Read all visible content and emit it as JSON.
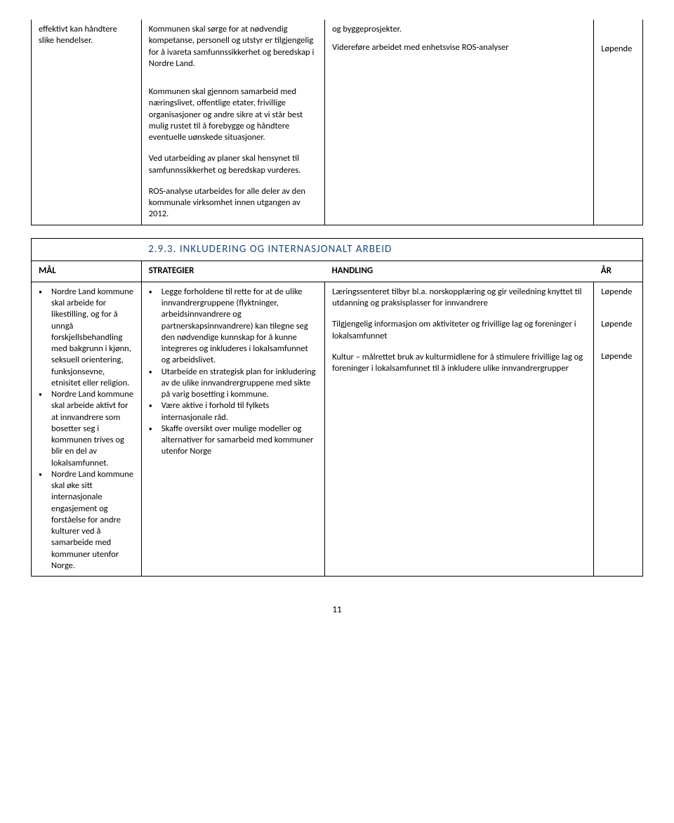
{
  "table1": {
    "row1": {
      "col1": "effektivt kan håndtere slike hendelser.",
      "col2": "Kommunen skal sørge for at nødvendig kompetanse, personell og utstyr er tilgjengelig for å ivareta samfunnssikkerhet og beredskap i Nordre Land.",
      "col3a": "og byggeprosjekter.",
      "col3b": "Videreføre arbeidet med enhetsvise ROS-analyser",
      "col4": "Løpende"
    },
    "row2": {
      "p1": "Kommunen skal gjennom samarbeid med næringslivet, offentlige etater, frivillige organisasjoner og andre sikre at vi står best mulig rustet til å forebygge og håndtere eventuelle uønskede situasjoner.",
      "p2": "Ved utarbeiding av planer skal hensynet til samfunnssikkerhet og beredskap vurderes.",
      "p3": "ROS-analyse utarbeides for alle deler av den kommunale virksomhet innen utgangen av 2012."
    }
  },
  "section_heading": "2.9.3. INKLUDERING OG INTERNASJONALT ARBEID",
  "headers": {
    "mal": "MÅL",
    "strategier": "STRATEGIER",
    "handling": "HANDLING",
    "ar": "ÅR"
  },
  "table2": {
    "mal": {
      "p1": "Nordre Land kommune skal arbeide for likestilling, og for å unngå forskjellsbehandling med bakgrunn i kjønn, seksuell orientering, funksjonsevne, etnisitet eller religion.",
      "p2": "Nordre Land kommune skal arbeide aktivt for at innvandrere som bosetter seg i kommunen trives og blir en del av lokalsamfunnet.",
      "p3": "Nordre Land kommune skal øke sitt internasjonale engasjement og forståelse for andre kulturer ved å samarbeide med kommuner utenfor Norge."
    },
    "strat": {
      "p1": "Legge forholdene til rette for at de ulike innvandrergruppene (flyktninger, arbeidsinnvandrere og partnerskapsinnvandrere) kan tilegne seg den nødvendige kunnskap for å kunne integreres og inkluderes i lokalsamfunnet og arbeidslivet.",
      "p2": "Utarbeide en strategisk plan for inkludering av de ulike innvandrergruppene med sikte på varig bosetting i kommune.",
      "p3": "Være aktive i forhold til fylkets internasjonale råd.",
      "p4": "Skaffe oversikt over mulige modeller og alternativer for samarbeid med kommuner utenfor Norge"
    },
    "hand": {
      "p1": "Læringssenteret tilbyr bl.a. norskopplæring og gir veiledning knyttet til utdanning og praksisplasser for innvandrere",
      "p2": "Tilgjengelig informasjon om aktiviteter og frivillige lag og foreninger i lokalsamfunnet",
      "p3": "Kultur – målrettet bruk av kulturmidlene for å stimulere frivillige lag og foreninger i lokalsamfunnet til å inkludere ulike innvandrergrupper"
    },
    "ar": {
      "p1": "Løpende",
      "p2": "Løpende",
      "p3": "Løpende"
    }
  },
  "page_number": "11"
}
